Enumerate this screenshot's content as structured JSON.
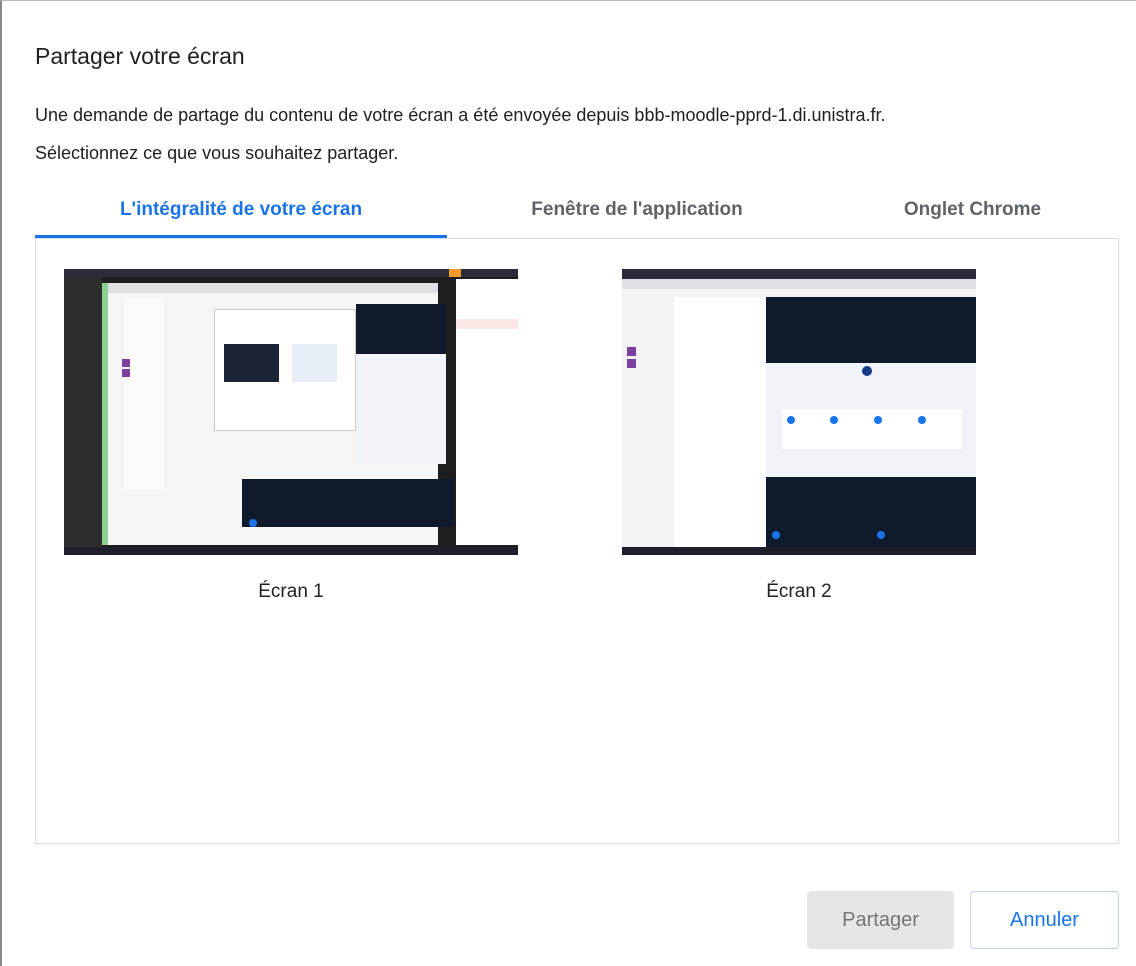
{
  "dialog": {
    "title": "Partager votre écran",
    "description_line1": "Une demande de partage du contenu de votre écran a été envoyée depuis bbb-moodle-pprd-1.di.unistra.fr.",
    "description_line2": "Sélectionnez ce que vous souhaitez partager."
  },
  "tabs": [
    {
      "label": "L'intégralité de votre écran",
      "active": true
    },
    {
      "label": "Fenêtre de l'application",
      "active": false
    },
    {
      "label": "Onglet Chrome",
      "active": false
    }
  ],
  "screens": [
    {
      "label": "Écran 1"
    },
    {
      "label": "Écran 2"
    }
  ],
  "buttons": {
    "share": "Partager",
    "cancel": "Annuler"
  },
  "colors": {
    "accent": "#1a73e8",
    "tab_inactive": "#5f6368",
    "disabled_bg": "#e6e6e6"
  }
}
